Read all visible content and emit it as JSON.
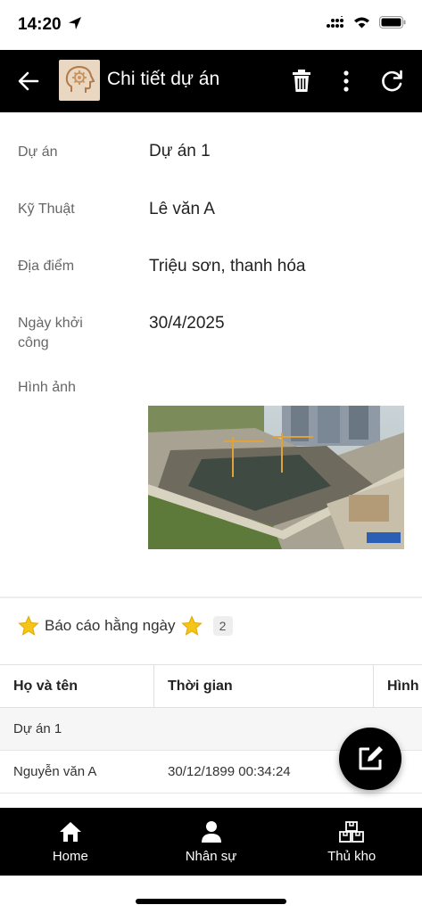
{
  "status_bar": {
    "time": "14:20"
  },
  "app_bar": {
    "title": "Chi tiết dự án",
    "icons": [
      "back-arrow-icon",
      "delete-icon",
      "more-vert-icon",
      "refresh-icon"
    ]
  },
  "details": {
    "project_label": "Dự án",
    "project_value": "Dự án 1",
    "technician_label": "Kỹ Thuật",
    "technician_value": "Lê văn A",
    "location_label": "Địa điểm",
    "location_value": "Triệu sơn, thanh hóa",
    "start_date_label": "Ngày khởi công",
    "start_date_value": "30/4/2025",
    "image_label": "Hình ảnh"
  },
  "daily_report": {
    "title": "Báo cáo hằng ngày",
    "count": "2",
    "columns": [
      "Họ và tên",
      "Thời gian",
      "Hình"
    ],
    "group": "Dự án 1",
    "rows": [
      {
        "name": "Nguyễn văn A",
        "time": "30/12/1899 00:34:24"
      }
    ]
  },
  "bottom_nav": [
    {
      "label": "Home",
      "icon": "home-icon"
    },
    {
      "label": "Nhân sự",
      "icon": "person-icon"
    },
    {
      "label": "Thủ kho",
      "icon": "warehouse-icon"
    }
  ],
  "colors": {
    "bar": "#000000",
    "background": "#ffffff",
    "star": "#f5c518"
  }
}
